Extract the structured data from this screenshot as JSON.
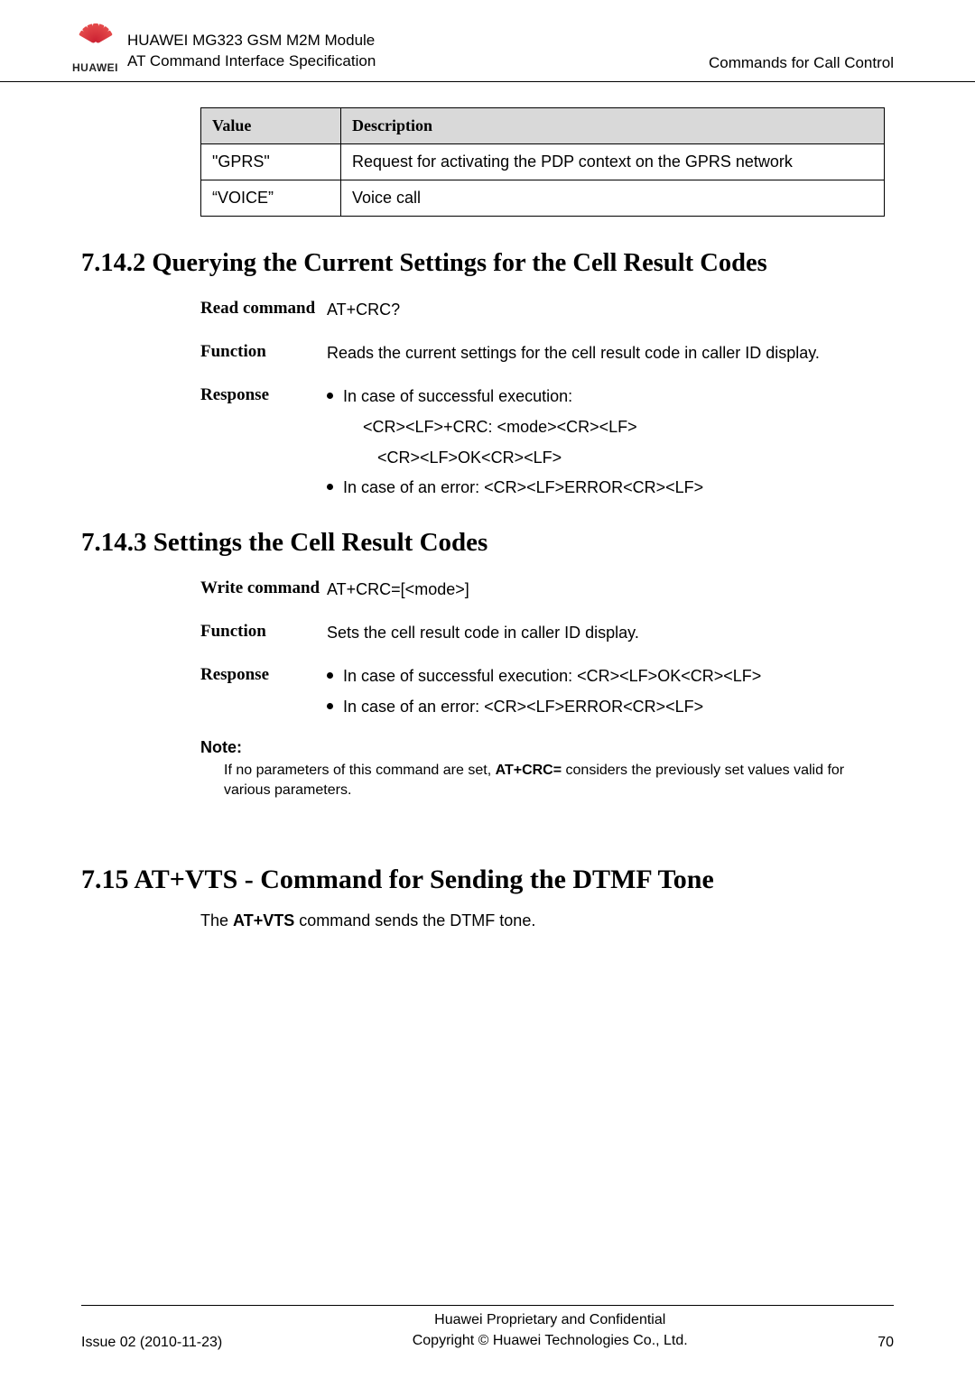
{
  "header": {
    "logo_label": "HUAWEI",
    "title_line1": "HUAWEI MG323 GSM M2M Module",
    "title_line2": "AT Command Interface Specification",
    "right": "Commands for Call Control"
  },
  "value_table": {
    "head_col1": "Value",
    "head_col2": "Description",
    "rows": [
      {
        "c1": "\"GPRS\"",
        "c2": "Request for activating the PDP context on the GPRS network"
      },
      {
        "c1": "“VOICE”",
        "c2": "Voice call"
      }
    ]
  },
  "sec_7_14_2": {
    "title": "7.14.2 Querying the Current Settings for the Cell Result Codes",
    "read_label": "Read command",
    "read_val": "AT+CRC?",
    "func_label": "Function",
    "func_val": "Reads the current settings for the cell result code in caller ID display.",
    "resp_label": "Response",
    "resp_b1": "In case of successful execution:",
    "resp_l2": "<CR><LF>+CRC: <mode><CR><LF>",
    "resp_l3": "<CR><LF>OK<CR><LF>",
    "resp_b2": "In case of an error: <CR><LF>ERROR<CR><LF>"
  },
  "sec_7_14_3": {
    "title": "7.14.3 Settings the Cell Result Codes",
    "write_label": "Write command",
    "write_val": "AT+CRC=[<mode>]",
    "func_label": "Function",
    "func_val": "Sets the cell result code in caller ID display.",
    "resp_label": "Response",
    "resp_b1": "In case of successful execution: <CR><LF>OK<CR><LF>",
    "resp_b2": "In case of an error: <CR><LF>ERROR<CR><LF>",
    "note_label": "Note:",
    "note_text": "If no parameters of this command are set, AT+CRC= considers the previously set values valid for various parameters."
  },
  "sec_7_15": {
    "title": "7.15 AT+VTS - Command for Sending the DTMF Tone",
    "body": "The AT+VTS command sends the DTMF tone."
  },
  "footer": {
    "left": "Issue 02 (2010-11-23)",
    "center_l1": "Huawei Proprietary and Confidential",
    "center_l2": "Copyright © Huawei Technologies Co., Ltd.",
    "right": "70"
  }
}
